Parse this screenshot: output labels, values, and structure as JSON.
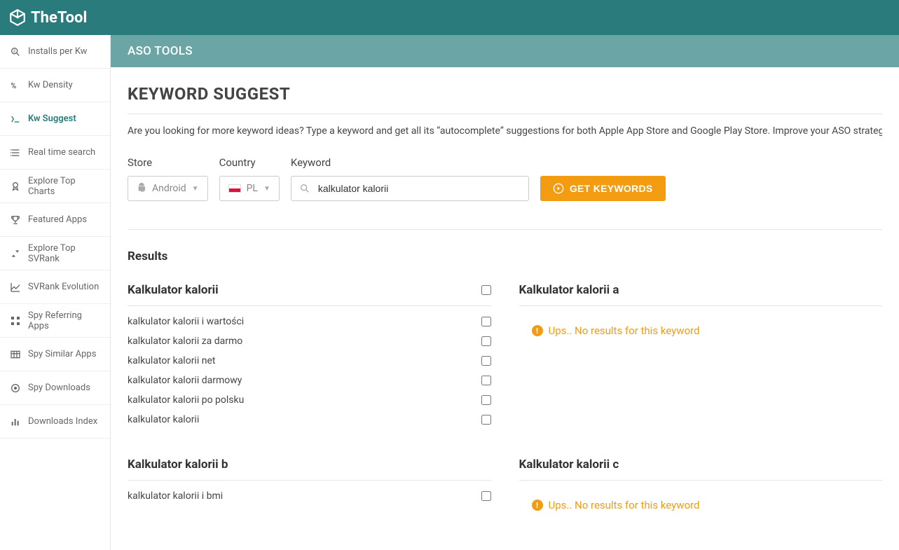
{
  "brand": "TheTool",
  "subheader": "ASO TOOLS",
  "sidebar": {
    "items": [
      {
        "label": "Installs per Kw",
        "icon": "installs"
      },
      {
        "label": "Kw Density",
        "icon": "density"
      },
      {
        "label": "Kw Suggest",
        "icon": "suggest",
        "active": true
      },
      {
        "label": "Real time search",
        "icon": "list"
      },
      {
        "label": "Explore Top Charts",
        "icon": "medal"
      },
      {
        "label": "Featured Apps",
        "icon": "trophy"
      },
      {
        "label": "Explore Top SVRank",
        "icon": "updown"
      },
      {
        "label": "SVRank Evolution",
        "icon": "chart"
      },
      {
        "label": "Spy Referring Apps",
        "icon": "grid"
      },
      {
        "label": "Spy Similar Apps",
        "icon": "table"
      },
      {
        "label": "Spy Downloads",
        "icon": "disc"
      },
      {
        "label": "Downloads Index",
        "icon": "bar"
      }
    ]
  },
  "page": {
    "title": "KEYWORD SUGGEST",
    "intro": "Are you looking for more keyword ideas? Type a keyword and get all its “autocomplete” suggestions for both Apple App Store and Google Play Store. Improve your ASO strategy with mid and l"
  },
  "filters": {
    "store_label": "Store",
    "store_value": "Android",
    "country_label": "Country",
    "country_value": "PL",
    "keyword_label": "Keyword",
    "keyword_value": "kalkulator kalorii",
    "button": "GET KEYWORDS"
  },
  "results": {
    "title": "Results",
    "no_results_text": "Ups.. No results for this keyword",
    "groups": [
      {
        "title": "Kalkulator kalorii",
        "has_header_checkbox": true,
        "items": [
          "kalkulator kalorii i wartości",
          "kalkulator kalorii za darmo",
          "kalkulator kalorii net",
          "kalkulator kalorii darmowy",
          "kalkulator kalorii po polsku",
          "kalkulator kalorii"
        ]
      },
      {
        "title": "Kalkulator kalorii a",
        "empty": true
      },
      {
        "title": "Kalkulator kalorii b",
        "has_header_checkbox": false,
        "items": [
          "kalkulator kalorii i bmi"
        ]
      },
      {
        "title": "Kalkulator kalorii c",
        "empty": true
      }
    ]
  }
}
